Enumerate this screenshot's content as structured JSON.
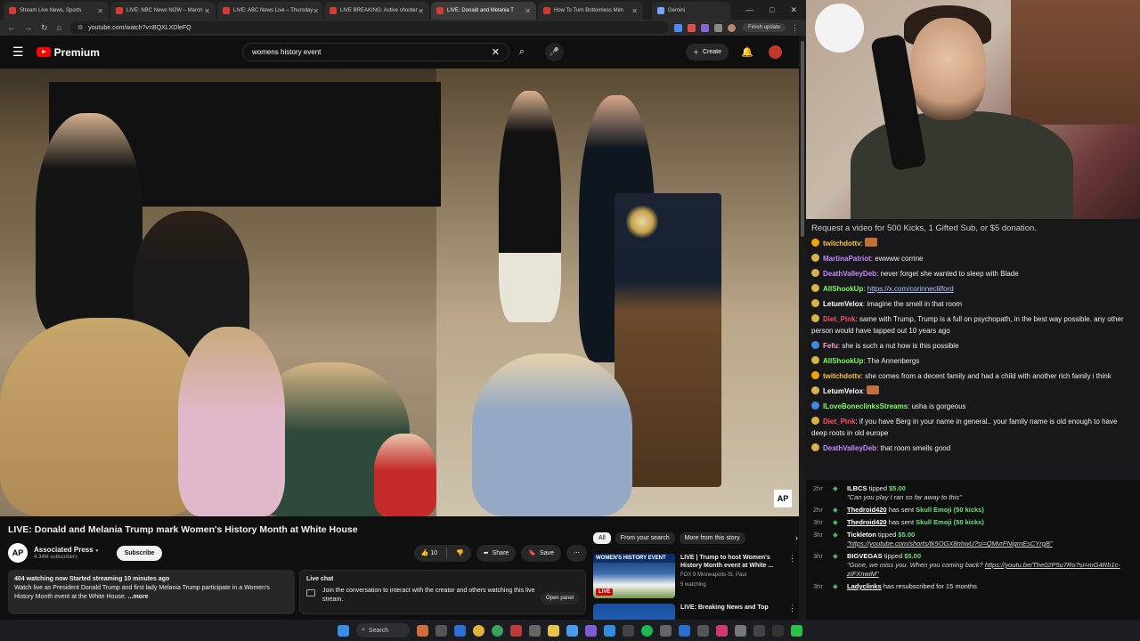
{
  "browser": {
    "tabs": [
      {
        "label": "Stream Live News, Sports",
        "color": "#d43a2f"
      },
      {
        "label": "LIVE: NBC News NOW – March",
        "color": "#d43a2f"
      },
      {
        "label": "LIVE: ABC News Live – Thursday",
        "color": "#d43a2f"
      },
      {
        "label": "LIVE BREAKING: Active shooter",
        "color": "#d43a2f"
      },
      {
        "label": "LIVE: Donald and Melania T",
        "color": "#d43a2f",
        "active": true
      },
      {
        "label": "How To Turn Bottomless Mim",
        "color": "#d43a2f"
      }
    ],
    "gemini_tab": "Gemini",
    "url": "youtube.com/watch?v=BQXLXDleFQ",
    "finish_update": "Finish update"
  },
  "youtube": {
    "logo": "Premium",
    "search_value": "womens history event",
    "create_label": "Create"
  },
  "video": {
    "title": "LIVE: Donald and Melania Trump mark Women's History Month at White House",
    "watermark": "AP",
    "channel_initials": "AP",
    "channel_name": "Associated Press",
    "subscribers": "4.34M subscribers",
    "subscribe_label": "Subscribe",
    "likes": "10",
    "share_label": "Share",
    "save_label": "Save"
  },
  "description": {
    "meta": "404 watching now  Started streaming 10 minutes ago",
    "text": "Watch live as President Donald Trump and first lady Melania Trump participate in a Women's History Month event at the White House. ",
    "more": "...more"
  },
  "live_chat": {
    "title": "Live chat",
    "body": "Join the conversation to interact with the creator and others watching this live stream.",
    "button": "Open panel"
  },
  "recommendations": {
    "chips": [
      "All",
      "From your search",
      "More from this story"
    ],
    "items": [
      {
        "thumb_label": "WOMEN'S HISTORY EVENT",
        "badge": "LIVE",
        "title": "LIVE | Trump to host Women's History Month event at White ...",
        "channel": "FOX 9 Minneapolis-St. Paul",
        "meta": "5 watching"
      },
      {
        "thumb_label": "",
        "badge": "",
        "title": "LIVE: Breaking News and Top",
        "channel": "",
        "meta": ""
      }
    ]
  },
  "chat": {
    "notice": "Request a video for 500 Kicks, 1 Gifted Sub, or $5 donation.",
    "messages": [
      {
        "user": "twitchdottv",
        "color": "#f5c542",
        "badge": "#f0a500",
        "text": ""
      },
      {
        "user": "MartinaPatriot",
        "color": "#c58aff",
        "badge": "#d8b34a",
        "text": "ewwww corrine"
      },
      {
        "user": "DeathValleyDeb",
        "color": "#c58aff",
        "badge": "#d8b34a",
        "text": "never forget she wanted to sleep with Blade"
      },
      {
        "user": "AllShookUp",
        "color": "#7cff5a",
        "badge": "#d8b34a",
        "text": "https://x.com/corinneclilford",
        "is_link": true
      },
      {
        "user": "LetumVelox",
        "color": "#ffffff",
        "badge": "#d8b34a",
        "text": "imagine the smell in that room"
      },
      {
        "user": "Diet_Pink",
        "color": "#ff4f6a",
        "badge": "#d8b34a",
        "text": "same with Trump, Trump is a full on psychopath, in the best way possible. any other person would have tapped out 10 years ago"
      },
      {
        "user": "Fefu",
        "color": "#ff9fd6",
        "badge": "#3d8be0",
        "text": "she is such a nut how is this possible"
      },
      {
        "user": "AllShookUp",
        "color": "#7cff5a",
        "badge": "#d8b34a",
        "text": "The Annenbergs"
      },
      {
        "user": "twitchdottv",
        "color": "#f5c542",
        "badge": "#f0a500",
        "text": "she comes from a decent family and had a child with another rich family i think"
      },
      {
        "user": "LetumVelox",
        "color": "#ffffff",
        "badge": "#d8b34a",
        "text": ""
      },
      {
        "user": "ILoveBoneclinksStreams",
        "color": "#7cff5a",
        "badge": "#3d8be0",
        "text": "usha is gorgeous"
      },
      {
        "user": "Diet_Pink",
        "color": "#ff4f6a",
        "badge": "#d8b34a",
        "text": "if you have Berg in your name in general.. your family name is old enough to have deep roots in old europe"
      },
      {
        "user": "DeathValleyDeb",
        "color": "#c58aff",
        "badge": "#d8b34a",
        "text": "that room smells good"
      }
    ]
  },
  "events": [
    {
      "time": "2hr",
      "who": "ILBCS",
      "action": "tipped",
      "amount": "$5.00",
      "quote": "\"Can you play I ran so far away to this\"",
      "quote_link": ""
    },
    {
      "time": "2hr",
      "who": "Thedroid420",
      "action": "has sent",
      "amount": "Skull Emoji (50 kicks)",
      "quote": "",
      "quote_link": ""
    },
    {
      "time": "3hr",
      "who": "Thedroid420",
      "action": "has sent",
      "amount": "Skull Emoji (50 kicks)",
      "quote": "",
      "quote_link": ""
    },
    {
      "time": "3hr",
      "who": "Tickleton",
      "action": "tipped",
      "amount": "$5.00",
      "quote": "",
      "quote_link": "\"https://youtube.com/shorts/tk5OGX8nhwU?si=QMvrFNigmEsCYrgB\""
    },
    {
      "time": "3hr",
      "who": "BIGVEGAS",
      "action": "tipped",
      "amount": "$5.00",
      "quote": "\"Gone, we miss you. When you coming back? ",
      "quote_link": "https://youtu.be/The02P5u7Ro?si=mG4Rb1c-zIFXnwiM\""
    },
    {
      "time": "3hr",
      "who": "Ladyclinks",
      "action": "has resubscribed for 15 months",
      "amount": "",
      "quote": "",
      "quote_link": ""
    }
  ],
  "taskbar": {
    "search_label": "Search"
  }
}
